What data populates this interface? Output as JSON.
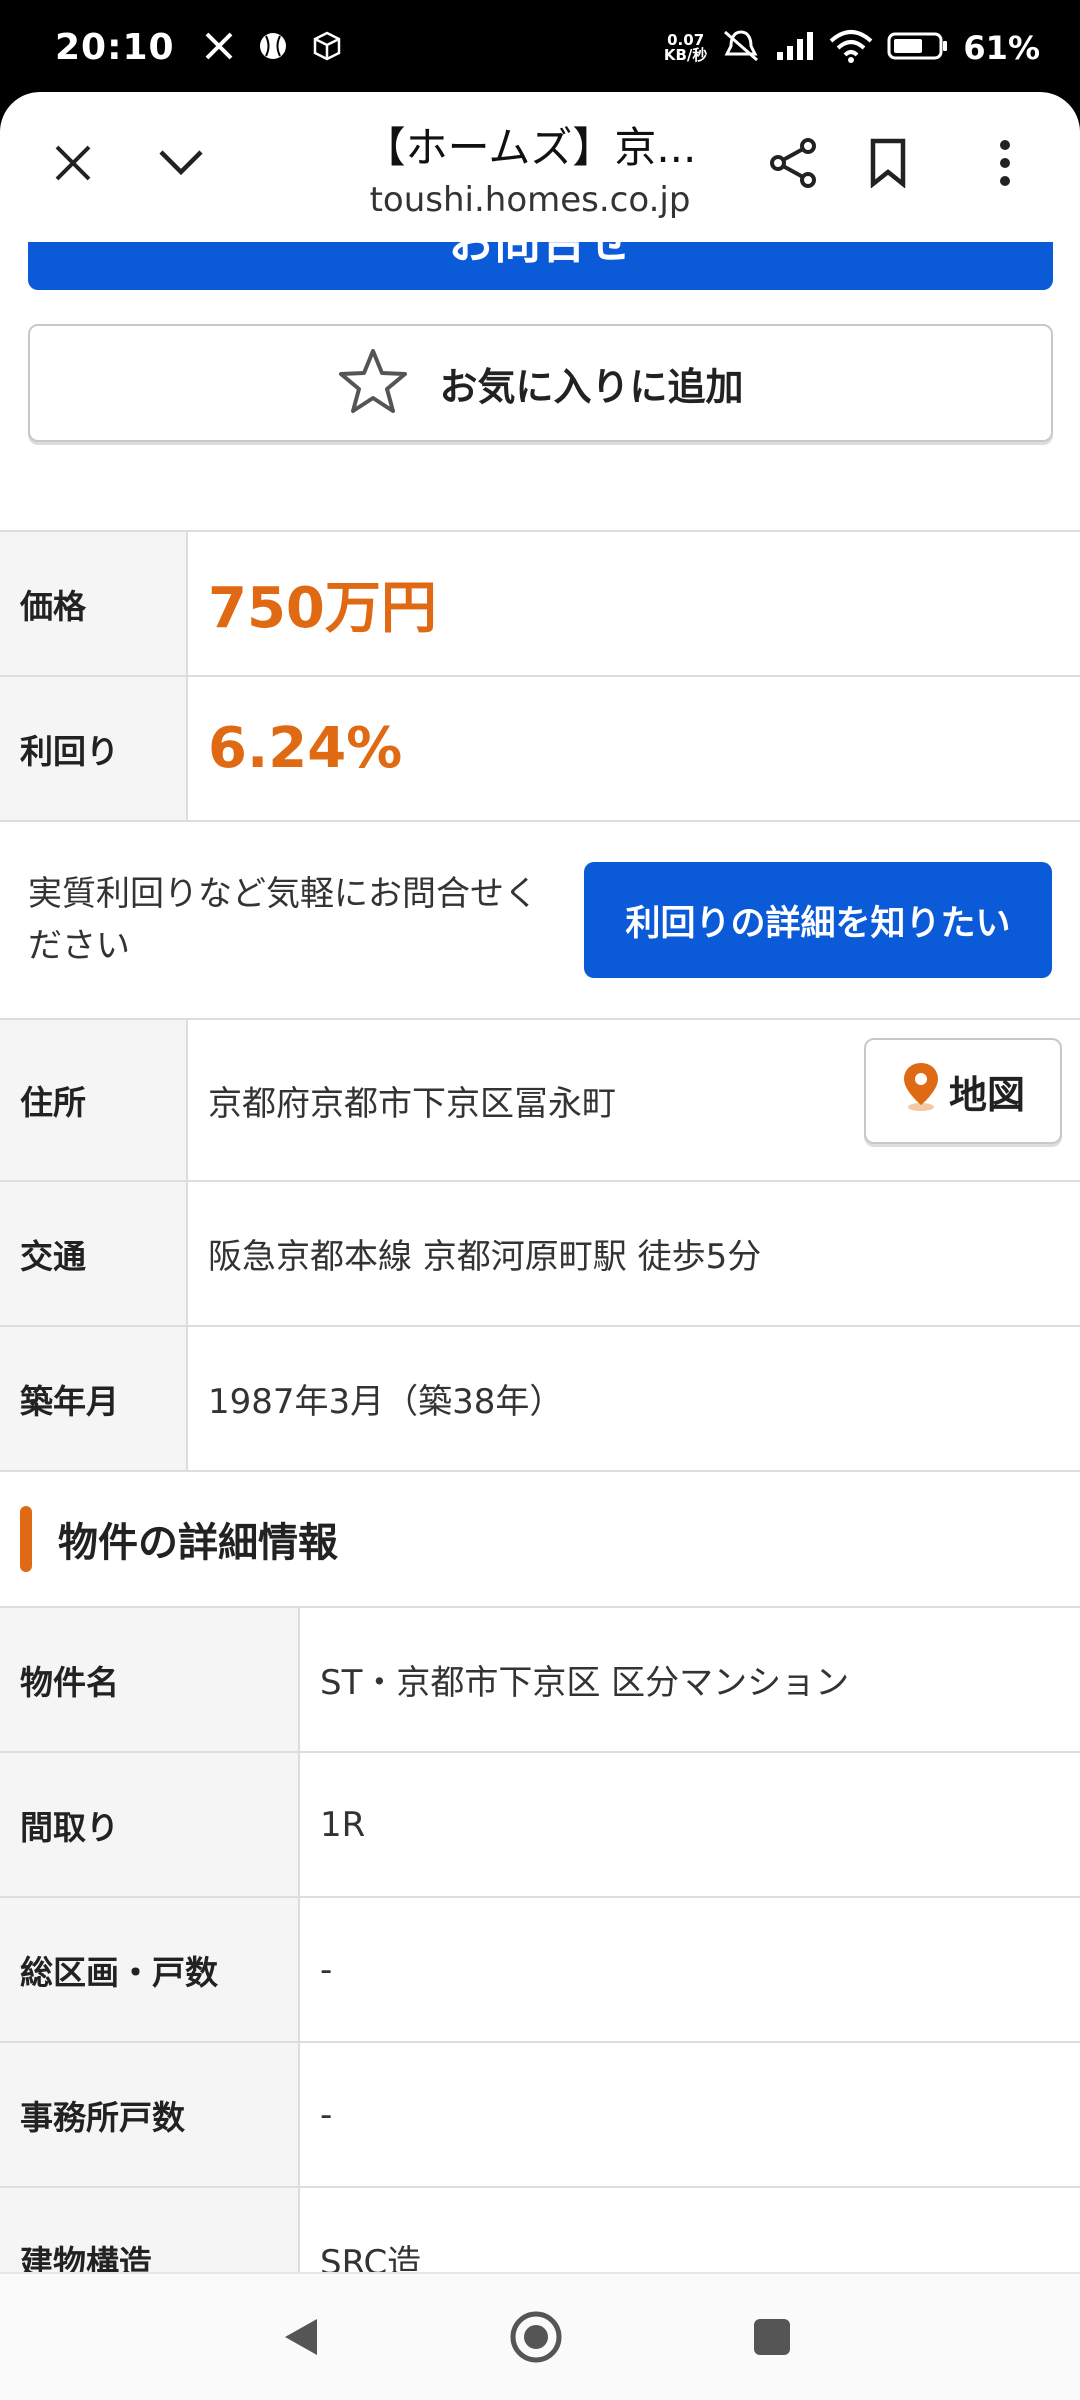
{
  "status_bar": {
    "time": "20:10",
    "net_speed_value": "0.07",
    "net_speed_unit": "KB/秒",
    "battery": "61%"
  },
  "browser": {
    "title": "【ホームズ】京...",
    "url": "toushi.homes.co.jp"
  },
  "actions": {
    "contact_label": "お問合せ",
    "favorite_label": "お気に入りに追加"
  },
  "summary": {
    "price_label": "価格",
    "price_value": "750万円",
    "yield_label": "利回り",
    "yield_value": "6.24%",
    "inquiry_text": "実質利回りなど気軽にお問合せください",
    "inquiry_button": "利回りの詳細を知りたい",
    "address_label": "住所",
    "address_value": "京都府京都市下京区冨永町",
    "map_button": "地図",
    "transit_label": "交通",
    "transit_value": "阪急京都本線 京都河原町駅 徒歩5分",
    "built_label": "築年月",
    "built_value": "1987年3月（築38年）"
  },
  "details": {
    "section_title": "物件の詳細情報",
    "rows": [
      {
        "label": "物件名",
        "value": "ST・京都市下京区 区分マンション"
      },
      {
        "label": "間取り",
        "value": "1R"
      },
      {
        "label": "総区画・戸数",
        "value": "-"
      },
      {
        "label": "事務所戸数",
        "value": "-"
      },
      {
        "label": "建物構造",
        "value": "SRC造"
      }
    ]
  },
  "colors": {
    "accent_orange": "#e06a14",
    "primary_blue": "#0b5ad8"
  }
}
